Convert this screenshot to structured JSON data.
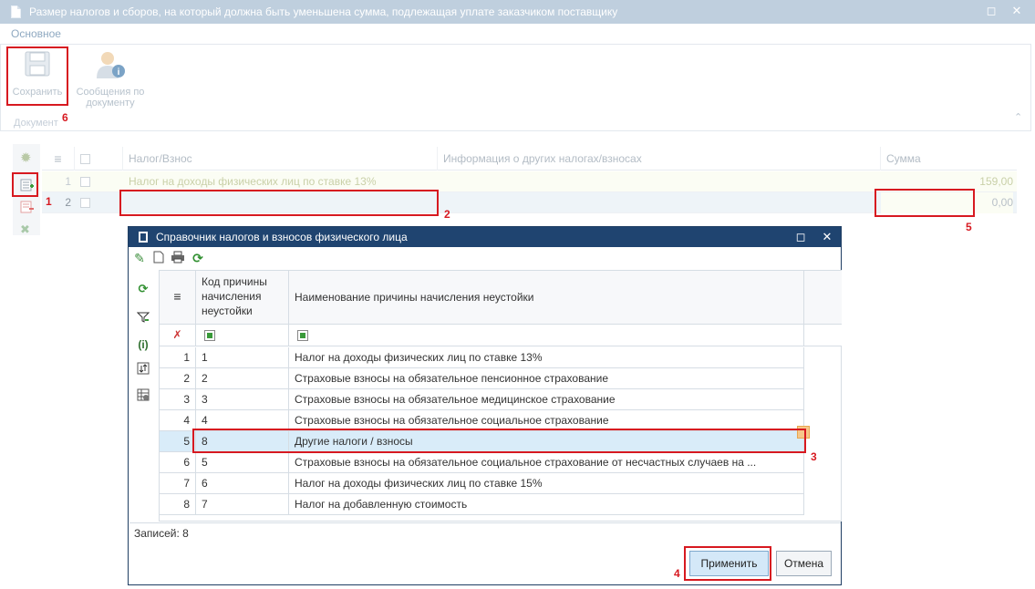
{
  "window": {
    "title": "Размер налогов и сборов, на который должна быть уменьшена сумма, подлежащая уплате заказчиком поставщику",
    "restore_glyph": "◻",
    "close_glyph": "✕"
  },
  "tabs": {
    "main": "Основное"
  },
  "ribbon": {
    "save_label": "Сохранить",
    "messages_label": "Сообщения по документу",
    "group_label": "Документ",
    "collapse_glyph": "⌃"
  },
  "grid": {
    "columns": {
      "tax": "Налог/Взнос",
      "info": "Информация о других налогах/взносах",
      "sum": "Сумма"
    },
    "menu_glyph": "≡",
    "rows": [
      {
        "num": "1",
        "tax": "Налог на доходы физических лиц по ставке 13%",
        "sum": "159,00"
      },
      {
        "num": "2",
        "tax": "",
        "sum": "0,00"
      }
    ]
  },
  "annotations": [
    "1",
    "2",
    "3",
    "4",
    "5",
    "6"
  ],
  "dialog": {
    "title": "Справочник налогов и взносов физического лица",
    "restore_glyph": "◻",
    "close_glyph": "✕",
    "menu_glyph": "≡",
    "clear_filter_glyph": "✗",
    "info_glyph": "(i)",
    "columns": {
      "code": "Код причины начисления неустойки",
      "name": "Наименование причины начисления неустойки"
    },
    "rows": [
      {
        "n": "1",
        "code": "1",
        "name": "Налог на доходы физических лиц по ставке 13%"
      },
      {
        "n": "2",
        "code": "2",
        "name": "Страховые взносы на обязательное пенсионное страхование"
      },
      {
        "n": "3",
        "code": "3",
        "name": "Страховые взносы на обязательное медицинское страхование"
      },
      {
        "n": "4",
        "code": "4",
        "name": "Страховые взносы на обязательное социальное страхование"
      },
      {
        "n": "5",
        "code": "8",
        "name": "Другие налоги / взносы"
      },
      {
        "n": "6",
        "code": "5",
        "name": "Страховые взносы на обязательное социальное страхование от несчастных случаев на ..."
      },
      {
        "n": "7",
        "code": "6",
        "name": "Налог на доходы физических лиц по ставке 15%"
      },
      {
        "n": "8",
        "code": "7",
        "name": "Налог на добавленную стоимость"
      }
    ],
    "records": "Записей: 8",
    "apply_label": "Применить",
    "cancel_label": "Отмена"
  },
  "colors": {
    "accent_red": "#d71920",
    "dialog_title": "#1f4470",
    "selected_row": "#d9ecf9"
  }
}
